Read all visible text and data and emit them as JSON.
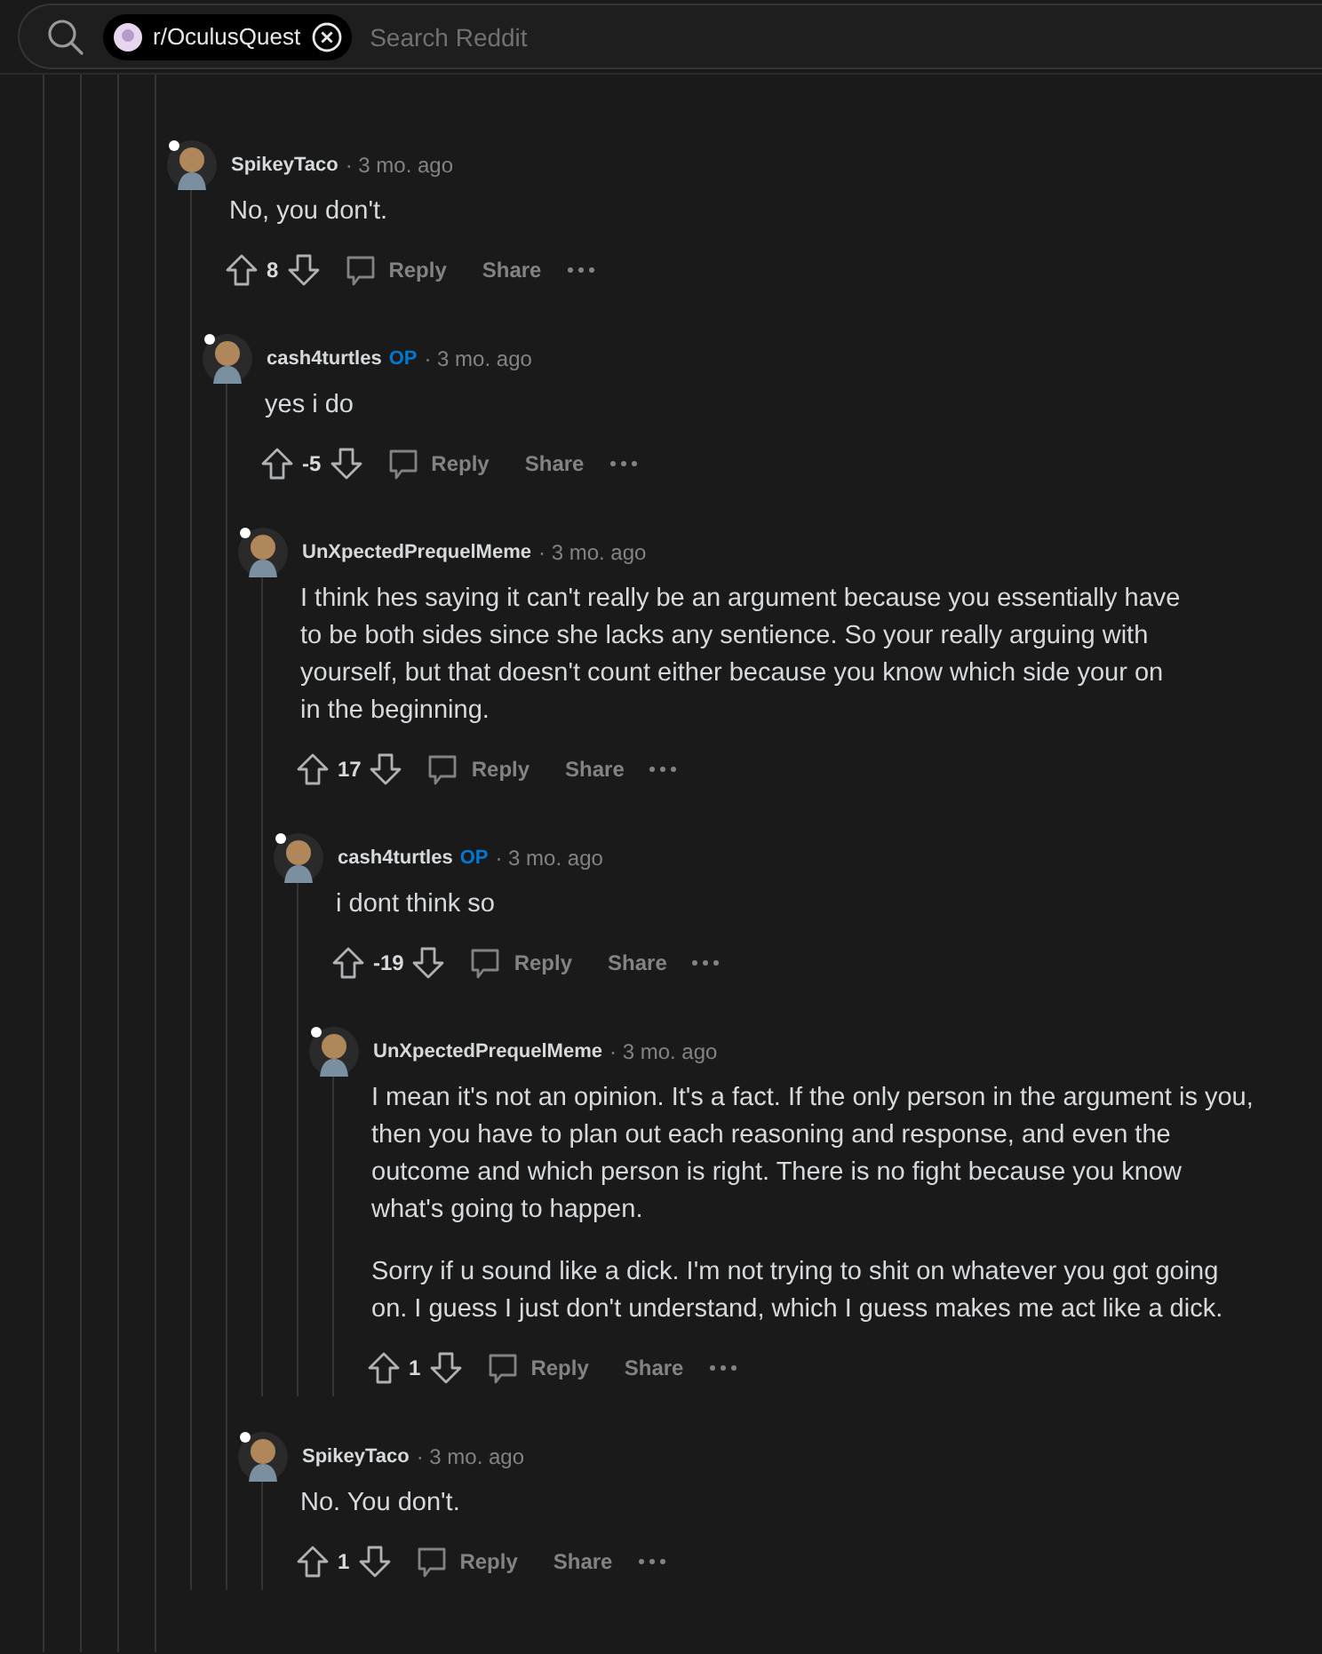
{
  "search": {
    "community": "r/OculusQuest",
    "placeholder": "Search Reddit"
  },
  "comments": [
    {
      "author": "SpikeyTaco",
      "time": "· 3 mo. ago",
      "paragraphs": [
        "No, you don't."
      ],
      "votes": "8",
      "reply": "Reply",
      "share": "Share",
      "children": [
        {
          "author": "cash4turtles",
          "badge": "OP",
          "time": "· 3 mo. ago",
          "paragraphs": [
            "yes i do"
          ],
          "votes": "-5",
          "reply": "Reply",
          "share": "Share",
          "children": [
            {
              "author": "UnXpectedPrequelMeme",
              "time": "· 3 mo. ago",
              "paragraphs": [
                "I think hes saying it can't really be an argument because you essentially have to be both sides since she lacks any sentience. So your really arguing with yourself, but that doesn't count either because you know which side your on in the beginning."
              ],
              "votes": "17",
              "reply": "Reply",
              "share": "Share",
              "children": [
                {
                  "author": "cash4turtles",
                  "badge": "OP",
                  "time": "· 3 mo. ago",
                  "paragraphs": [
                    "i dont think so"
                  ],
                  "votes": "-19",
                  "reply": "Reply",
                  "share": "Share",
                  "children": [
                    {
                      "author": "UnXpectedPrequelMeme",
                      "time": "· 3 mo. ago",
                      "paragraphs": [
                        "I mean it's not an opinion. It's a fact. If the only person in the argument is you, then you have to plan out each reasoning and response, and even the outcome and which person is right. There is no fight because you know what's going to happen.",
                        "Sorry if u sound like a dick. I'm not trying to shit on whatever you got going on. I guess I just don't understand, which I guess makes me act like a dick."
                      ],
                      "votes": "1",
                      "reply": "Reply",
                      "share": "Share"
                    }
                  ]
                }
              ]
            },
            {
              "author": "SpikeyTaco",
              "time": "· 3 mo. ago",
              "paragraphs": [
                "No. You don't."
              ],
              "votes": "1",
              "reply": "Reply",
              "share": "Share"
            }
          ]
        }
      ]
    }
  ]
}
